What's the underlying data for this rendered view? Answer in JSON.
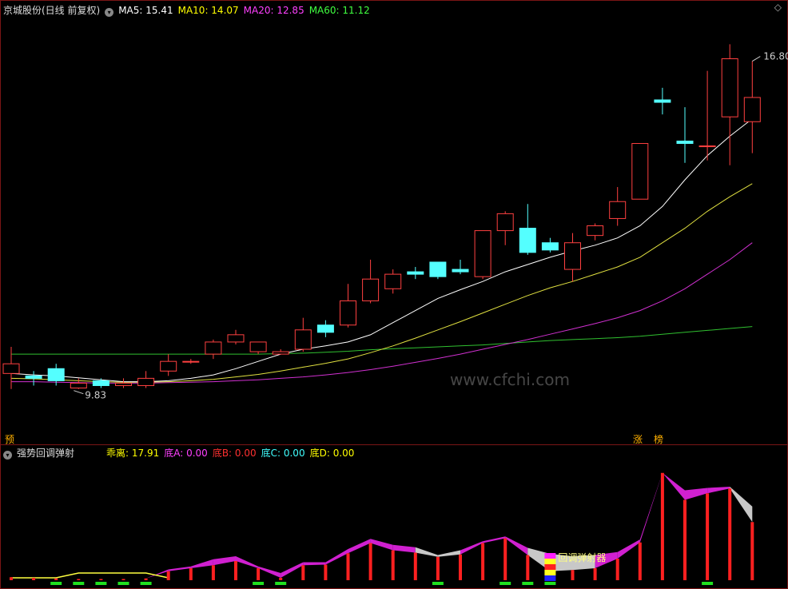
{
  "main": {
    "title": "京城股份(日线 前复权)",
    "ma_labels": [
      {
        "text": "MA5: 15.41",
        "color": "#ffffff"
      },
      {
        "text": "MA10: 14.07",
        "color": "#ffff00"
      },
      {
        "text": "MA20: 12.85",
        "color": "#ff40ff"
      },
      {
        "text": "MA60: 11.12",
        "color": "#40ff40"
      }
    ],
    "high_label": "16.80",
    "low_label": "9.83",
    "tag_pre": "预",
    "tag_zhang": "涨",
    "tag_bang": "榜",
    "watermark": "www.cfchi.com",
    "diamond": "◇"
  },
  "sub": {
    "title": "强势回调弹射",
    "labels": [
      {
        "text": "乖离: 17.91",
        "color": "#ffff00"
      },
      {
        "text": "底A: 0.00",
        "color": "#ff40ff"
      },
      {
        "text": "底B: 0.00",
        "color": "#ff3030"
      },
      {
        "text": "底C: 0.00",
        "color": "#40ffff"
      },
      {
        "text": "底D: 0.00",
        "color": "#ffff00"
      }
    ],
    "signal_text": "回调弹射器"
  },
  "chart_data": {
    "type": "candlestick",
    "price_axis": {
      "min": 9.0,
      "max": 17.5
    },
    "candles": [
      [
        10.15,
        10.35,
        9.83,
        10.7
      ],
      [
        10.1,
        10.05,
        9.9,
        10.2
      ],
      [
        10.25,
        10.0,
        9.9,
        10.35
      ],
      [
        9.85,
        9.95,
        9.83,
        10.05
      ],
      [
        10.0,
        9.9,
        9.85,
        10.05
      ],
      [
        9.9,
        9.95,
        9.85,
        10.05
      ],
      [
        9.9,
        10.05,
        9.85,
        10.2
      ],
      [
        10.2,
        10.4,
        10.1,
        10.55
      ],
      [
        10.4,
        10.4,
        10.35,
        10.45
      ],
      [
        10.55,
        10.8,
        10.45,
        10.85
      ],
      [
        10.8,
        10.95,
        10.75,
        11.05
      ],
      [
        10.6,
        10.8,
        10.55,
        10.8
      ],
      [
        10.55,
        10.6,
        10.55,
        10.65
      ],
      [
        10.65,
        11.05,
        10.6,
        11.3
      ],
      [
        11.15,
        11.0,
        10.9,
        11.25
      ],
      [
        11.15,
        11.65,
        11.1,
        12.0
      ],
      [
        11.65,
        12.1,
        11.6,
        12.5
      ],
      [
        11.9,
        12.2,
        11.8,
        12.3
      ],
      [
        12.25,
        12.2,
        12.1,
        12.35
      ],
      [
        12.45,
        12.15,
        12.1,
        12.4
      ],
      [
        12.3,
        12.25,
        12.2,
        12.5
      ],
      [
        12.15,
        13.1,
        12.1,
        13.1
      ],
      [
        13.1,
        13.45,
        12.8,
        13.5
      ],
      [
        13.15,
        12.65,
        12.6,
        13.65
      ],
      [
        12.85,
        12.7,
        12.65,
        12.95
      ],
      [
        12.3,
        12.85,
        12.05,
        13.05
      ],
      [
        13.0,
        13.2,
        12.9,
        13.25
      ],
      [
        13.35,
        13.7,
        13.2,
        14.0
      ],
      [
        13.75,
        14.9,
        13.8,
        14.9
      ],
      [
        15.8,
        15.75,
        15.5,
        16.05
      ],
      [
        14.95,
        14.9,
        14.5,
        15.65
      ],
      [
        14.85,
        14.85,
        14.55,
        16.4
      ],
      [
        15.45,
        16.65,
        14.45,
        16.95
      ],
      [
        15.35,
        15.85,
        14.7,
        16.6
      ]
    ],
    "ma5": [
      10.15,
      10.12,
      10.1,
      10.06,
      10.02,
      9.98,
      9.98,
      10.0,
      10.05,
      10.12,
      10.25,
      10.4,
      10.55,
      10.65,
      10.72,
      10.8,
      10.95,
      11.2,
      11.45,
      11.7,
      11.88,
      12.05,
      12.25,
      12.4,
      12.55,
      12.68,
      12.8,
      12.95,
      13.2,
      13.6,
      14.15,
      14.65,
      15.05,
      15.41
    ],
    "ma10": [
      10.05,
      10.04,
      10.02,
      10.0,
      9.98,
      9.97,
      9.97,
      9.98,
      10.0,
      10.03,
      10.08,
      10.13,
      10.2,
      10.28,
      10.36,
      10.45,
      10.58,
      10.72,
      10.88,
      11.05,
      11.22,
      11.4,
      11.58,
      11.76,
      11.92,
      12.05,
      12.2,
      12.35,
      12.55,
      12.85,
      13.15,
      13.5,
      13.8,
      14.07
    ],
    "ma20": [
      9.98,
      9.98,
      9.97,
      9.96,
      9.95,
      9.95,
      9.95,
      9.96,
      9.97,
      9.98,
      10.0,
      10.02,
      10.05,
      10.08,
      10.12,
      10.17,
      10.23,
      10.3,
      10.38,
      10.46,
      10.55,
      10.65,
      10.75,
      10.85,
      10.96,
      11.07,
      11.18,
      11.3,
      11.45,
      11.65,
      11.9,
      12.2,
      12.5,
      12.85
    ],
    "ma60": [
      10.55,
      10.55,
      10.55,
      10.55,
      10.55,
      10.55,
      10.55,
      10.55,
      10.55,
      10.55,
      10.55,
      10.55,
      10.56,
      10.57,
      10.59,
      10.61,
      10.64,
      10.66,
      10.68,
      10.7,
      10.72,
      10.74,
      10.77,
      10.8,
      10.83,
      10.85,
      10.87,
      10.89,
      10.92,
      10.96,
      11.0,
      11.04,
      11.08,
      11.12
    ],
    "sub_axis": {
      "min": 0,
      "max": 20
    },
    "bias": [
      0.5,
      0.4,
      0.3,
      0.2,
      0.2,
      0.2,
      0.3,
      1.5,
      2.0,
      2.5,
      3.2,
      2.0,
      0.4,
      2.5,
      2.6,
      4.5,
      6.2,
      5.0,
      4.6,
      3.9,
      4.3,
      6.2,
      7.0,
      4.2,
      1.5,
      1.7,
      2.0,
      3.6,
      6.3,
      17.9,
      13.4,
      14.5,
      15.3,
      9.7
    ],
    "cloud_upper": [
      0.5,
      0.4,
      0.3,
      0.2,
      0.2,
      0.2,
      0.3,
      1.8,
      2.3,
      3.5,
      4.0,
      2.3,
      1.2,
      3.0,
      3.0,
      5.2,
      6.9,
      5.9,
      5.5,
      4.2,
      5.0,
      6.5,
      7.3,
      5.4,
      4.4,
      4.0,
      4.2,
      4.7,
      6.8,
      17.9,
      15.0,
      15.4,
      15.6,
      12.3
    ],
    "signal_index": 24,
    "green_marks": [
      2,
      3,
      4,
      5,
      6,
      11,
      12,
      19,
      22,
      23,
      24,
      31
    ]
  }
}
